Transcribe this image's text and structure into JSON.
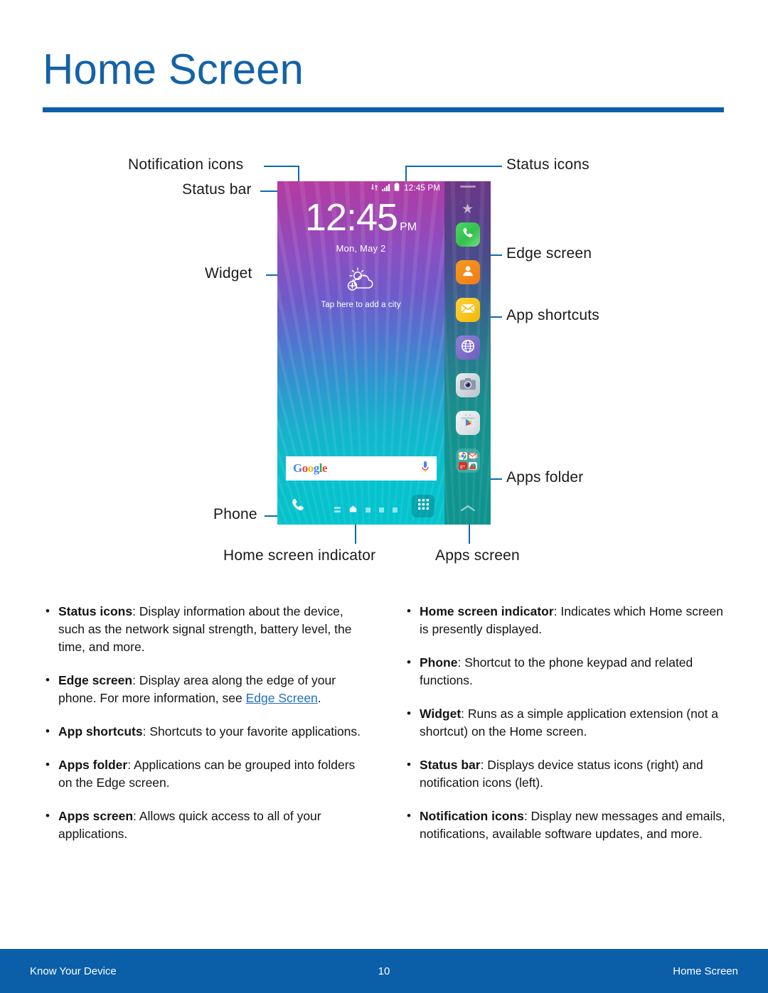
{
  "header": {
    "title": "Home Screen",
    "accent_color": "#0b5ea8",
    "title_color": "#1462a8"
  },
  "diagram": {
    "callouts": {
      "notification_icons": "Notification icons",
      "status_bar": "Status bar",
      "widget": "Widget",
      "phone": "Phone",
      "home_screen_indicator": "Home screen indicator",
      "apps_screen": "Apps screen",
      "status_icons": "Status icons",
      "edge_screen": "Edge screen",
      "app_shortcuts": "App shortcuts",
      "apps_folder": "Apps folder"
    },
    "leader_color": "#0f68b4",
    "phone_screen": {
      "status_bar": {
        "time": "12:45 PM",
        "icons": [
          "network-transfer-icon",
          "signal-bars-icon",
          "battery-icon"
        ]
      },
      "clock_widget": {
        "time": "12:45",
        "ampm": "PM",
        "date": "Mon, May 2"
      },
      "weather_widget": {
        "icon": "sun-cloud-add-icon",
        "caption": "Tap here to add a city"
      },
      "search_bar": {
        "logo_letters": [
          "G",
          "o",
          "o",
          "g",
          "l",
          "e"
        ],
        "mic_icon": "microphone-icon"
      },
      "dock": {
        "phone_icon": "phone-handset-icon",
        "apps_icon": "apps-grid-icon",
        "indicators": [
          "list-page-icon",
          "home-page-icon",
          "page-dot",
          "page-dot",
          "page-dot"
        ],
        "active_index": 1
      },
      "edge_panel": {
        "handle": "drag-handle-icon",
        "favorite_icon": "star-icon",
        "chevron_icon": "chevron-up-icon",
        "shortcuts": [
          {
            "name": "phone-shortcut",
            "icon": "phone-handset-icon",
            "color": "#35bf4e"
          },
          {
            "name": "contacts-shortcut",
            "icon": "contact-person-icon",
            "color": "#f07c16"
          },
          {
            "name": "email-shortcut",
            "icon": "envelope-icon",
            "color": "#f2b705"
          },
          {
            "name": "internet-shortcut",
            "icon": "globe-icon",
            "color": "#6f5fc0"
          },
          {
            "name": "camera-shortcut",
            "icon": "camera-icon",
            "color": "#b8c3cc"
          },
          {
            "name": "play-store-shortcut",
            "icon": "play-store-icon",
            "color": "#cfd6dc"
          }
        ],
        "folder": {
          "name": "apps-folder",
          "mini_icons": [
            "chrome-icon",
            "gmail-icon",
            "google-plus-icon",
            "maps-icon"
          ]
        }
      }
    }
  },
  "body": {
    "left_column": [
      {
        "term": "Status icons",
        "text": ": Display information about the device, such as the network signal strength, battery level, the time, and more."
      },
      {
        "term": "Edge screen",
        "text": ": Display area along the edge of your phone. For more information, see ",
        "link": "Edge Screen",
        "text_after": "."
      },
      {
        "term": "App shortcuts",
        "text": ": Shortcuts to your favorite applications."
      },
      {
        "term": "Apps folder",
        "text": ": Applications can be grouped into folders on the Edge screen."
      },
      {
        "term": "Apps screen",
        "text": ": Allows quick access to all of your applications."
      }
    ],
    "right_column": [
      {
        "term": "Home screen indicator",
        "text": ": Indicates which Home screen is presently displayed."
      },
      {
        "term": "Phone",
        "text": ": Shortcut to the phone keypad and related functions."
      },
      {
        "term": "Widget",
        "text": ": Runs as a simple application extension (not a shortcut) on the Home screen."
      },
      {
        "term": "Status bar",
        "text": ": Displays device status icons (right) and notification icons (left)."
      },
      {
        "term": "Notification icons",
        "text": ": Display new messages and emails, notifications, available software updates, and more."
      }
    ]
  },
  "footer": {
    "left": "Know Your Device",
    "page_number": "10",
    "right": "Home Screen",
    "background": "#0b5ea8"
  }
}
